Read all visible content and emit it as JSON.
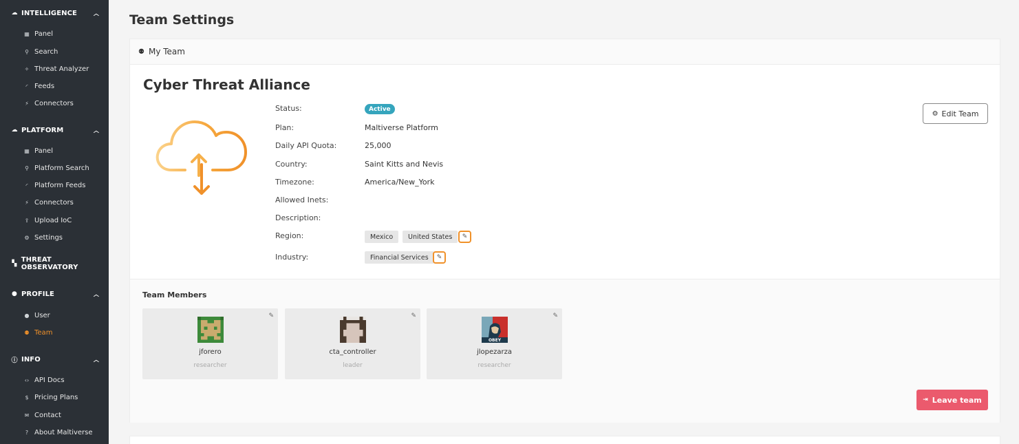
{
  "sidebar": {
    "sections": [
      {
        "label": "INTELLIGENCE",
        "icon": "cloud-icon",
        "items": [
          {
            "label": "Panel",
            "icon": "grid-icon"
          },
          {
            "label": "Search",
            "icon": "search-icon"
          },
          {
            "label": "Threat Analyzer",
            "icon": "sparkle-icon"
          },
          {
            "label": "Feeds",
            "icon": "rss-icon"
          },
          {
            "label": "Connectors",
            "icon": "plug-icon"
          }
        ]
      },
      {
        "label": "PLATFORM",
        "icon": "cloud-icon",
        "items": [
          {
            "label": "Panel",
            "icon": "grid-icon"
          },
          {
            "label": "Platform Search",
            "icon": "search-icon"
          },
          {
            "label": "Platform Feeds",
            "icon": "rss-icon"
          },
          {
            "label": "Connectors",
            "icon": "plug-icon"
          },
          {
            "label": "Upload IoC",
            "icon": "upload-icon"
          },
          {
            "label": "Settings",
            "icon": "gears-icon"
          }
        ]
      },
      {
        "label": "THREAT OBSERVATORY",
        "icon": "binoculars-icon",
        "items": []
      },
      {
        "label": "PROFILE",
        "icon": "user-icon",
        "items": [
          {
            "label": "User",
            "icon": "user-icon"
          },
          {
            "label": "Team",
            "icon": "users-icon"
          }
        ]
      },
      {
        "label": "INFO",
        "icon": "info-icon",
        "items": [
          {
            "label": "API Docs",
            "icon": "code-icon"
          },
          {
            "label": "Pricing Plans",
            "icon": "dollar-icon"
          },
          {
            "label": "Contact",
            "icon": "envelope-icon"
          },
          {
            "label": "About Maltiverse",
            "icon": "question-icon"
          }
        ]
      }
    ]
  },
  "page": {
    "title": "Team Settings"
  },
  "panel": {
    "header": "My Team"
  },
  "team": {
    "name": "Cyber Threat Alliance",
    "labels": {
      "status": "Status:",
      "plan": "Plan:",
      "quota": "Daily API Quota:",
      "country": "Country:",
      "timezone": "Timezone:",
      "inets": "Allowed Inets:",
      "description": "Description:",
      "region": "Region:",
      "industry": "Industry:"
    },
    "status": "Active",
    "plan": "Maltiverse Platform",
    "quota": "25,000",
    "country": "Saint Kitts and Nevis",
    "timezone": "America/New_York",
    "regions": [
      "Mexico",
      "United States"
    ],
    "industries": [
      "Financial Services"
    ]
  },
  "buttons": {
    "edit_team": "Edit Team",
    "leave_team": "Leave team"
  },
  "members": {
    "title": "Team Members",
    "list": [
      {
        "name": "jforero",
        "role": "researcher"
      },
      {
        "name": "cta_controller",
        "role": "leader"
      },
      {
        "name": "jlopezarza",
        "role": "researcher"
      }
    ]
  },
  "colors": {
    "sidebar_bg": "#2b3036",
    "accent": "#f0912a",
    "status_active": "#35a5bd",
    "danger": "#eb5a6d"
  }
}
